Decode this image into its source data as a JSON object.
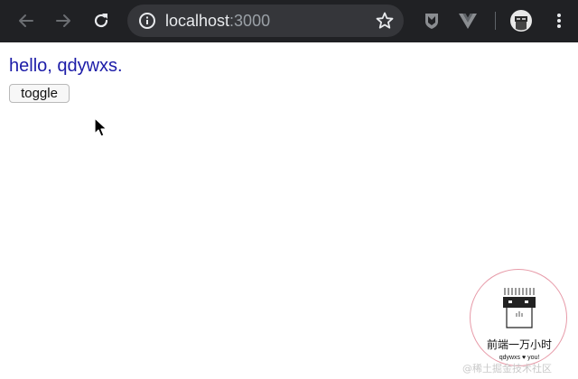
{
  "browser": {
    "url_host": "localhost",
    "url_port": ":3000",
    "icons": [
      "back-arrow-icon",
      "forward-arrow-icon",
      "reload-icon",
      "info-icon",
      "star-icon",
      "shield-extension-icon",
      "vue-devtools-icon",
      "avatar-icon",
      "menu-icon"
    ]
  },
  "page": {
    "greeting": "hello, qdywxs.",
    "toggle_label": "toggle"
  },
  "watermark": {
    "title": "前端一万小时",
    "subtitle": "qdywxs ♥ you!",
    "site": "@稀土掘金技术社区"
  },
  "colors": {
    "toolbar": "#202124",
    "omnibox": "#35363a",
    "greeting": "#1c1ca8",
    "badge_border": "#e79aa8"
  }
}
